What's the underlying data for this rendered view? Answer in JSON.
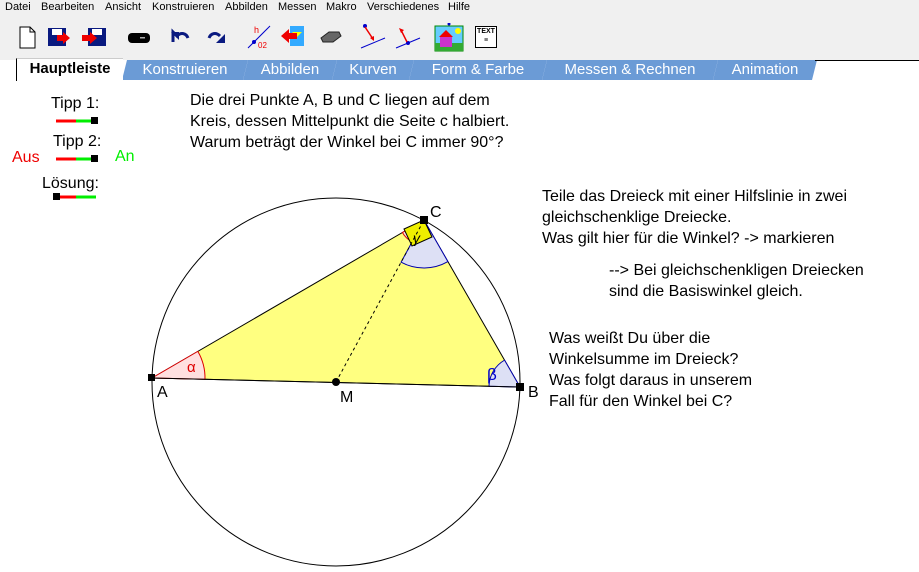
{
  "menu": [
    "Datei",
    "Bearbeiten",
    "Ansicht",
    "Konstruieren",
    "Abbilden",
    "Messen",
    "Makro",
    "Verschiedenes",
    "Hilfe"
  ],
  "toolbar": {
    "icons": [
      "new-file-icon",
      "save-icon",
      "save-as-icon",
      "print-icon",
      "undo-icon",
      "redo-icon",
      "label-icon",
      "color-icon",
      "eraser-icon",
      "move-point-icon",
      "bind-point-icon",
      "background-image-icon",
      "text-icon"
    ],
    "text_icon_label": "TEXT"
  },
  "tabs": [
    "Hauptleiste",
    "Konstruieren",
    "Abbilden",
    "Kurven",
    "Form & Farbe",
    "Messen & Rechnen",
    "Animation"
  ],
  "controls": {
    "tipp1": "Tipp 1:",
    "tipp2": "Tipp 2:",
    "loesung": "Lösung:",
    "aus": "Aus",
    "an": "An",
    "tipp1_value": 1,
    "tipp2_value": 1,
    "loesung_value": 0
  },
  "question": [
    "Die drei Punkte A, B und C liegen auf dem",
    "Kreis, dessen Mittelpunkt die Seite c halbiert.",
    "Warum beträgt der Winkel bei C immer 90°?"
  ],
  "hint1": [
    "Teile das Dreieck mit einer Hilfslinie in zwei",
    "gleichschenklige Dreiecke.",
    "Was gilt hier für die Winkel? -> markieren"
  ],
  "hint1b": [
    "--> Bei gleichschenkligen Dreiecken",
    "sind die Basiswinkel gleich."
  ],
  "hint2": [
    "Was weißt Du über die",
    "Winkelsumme im Dreieck?",
    "Was folgt daraus in unserem",
    "Fall für den Winkel bei C?"
  ],
  "points": {
    "A": "A",
    "B": "B",
    "C": "C",
    "M": "M"
  },
  "angles": {
    "alpha": "α",
    "beta": "β",
    "gamma": "γ"
  },
  "colors": {
    "tab": "#6b9bd6",
    "triangle": "#ffff80",
    "alpha": "#ffe0e0",
    "beta": "#dde0f5",
    "off": "#ff0000",
    "on": "#00ee00"
  }
}
